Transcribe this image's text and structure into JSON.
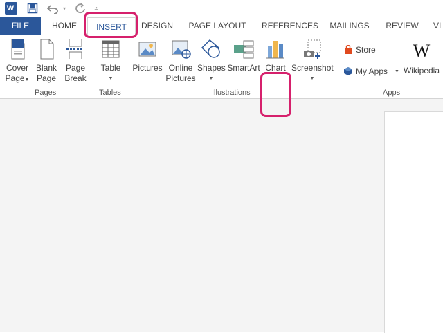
{
  "quick_access": {
    "app_logo": "W",
    "icons": [
      "word-app-icon",
      "save-icon",
      "undo-icon",
      "redo-icon",
      "customize-qat-icon"
    ]
  },
  "tabs": [
    {
      "label": "FILE"
    },
    {
      "label": "HOME"
    },
    {
      "label": "INSERT"
    },
    {
      "label": "DESIGN"
    },
    {
      "label": "PAGE LAYOUT"
    },
    {
      "label": "REFERENCES"
    },
    {
      "label": "MAILINGS"
    },
    {
      "label": "REVIEW"
    },
    {
      "label": "VI"
    }
  ],
  "active_tab": "INSERT",
  "ribbon": {
    "pages": {
      "group_label": "Pages",
      "cover_page": [
        "Cover",
        "Page"
      ],
      "blank_page": [
        "Blank",
        "Page"
      ],
      "page_break": [
        "Page",
        "Break"
      ]
    },
    "tables": {
      "group_label": "Tables",
      "table": "Table"
    },
    "illustrations": {
      "group_label": "Illustrations",
      "pictures": "Pictures",
      "online_pictures": [
        "Online",
        "Pictures"
      ],
      "shapes": "Shapes",
      "smartart": "SmartArt",
      "chart": "Chart",
      "screenshot": "Screenshot"
    },
    "apps": {
      "group_label": "Apps",
      "store": "Store",
      "my_apps": "My Apps",
      "wikipedia": "Wikipedia",
      "wikipedia_logo": "W"
    }
  },
  "colors": {
    "accent": "#2b579a",
    "highlight": "#d6206c",
    "store": "#e04a1f",
    "chart_bar_1": "#7da7d9",
    "chart_bar_2": "#f0b64d",
    "chart_bar_3": "#5a8ac6"
  }
}
